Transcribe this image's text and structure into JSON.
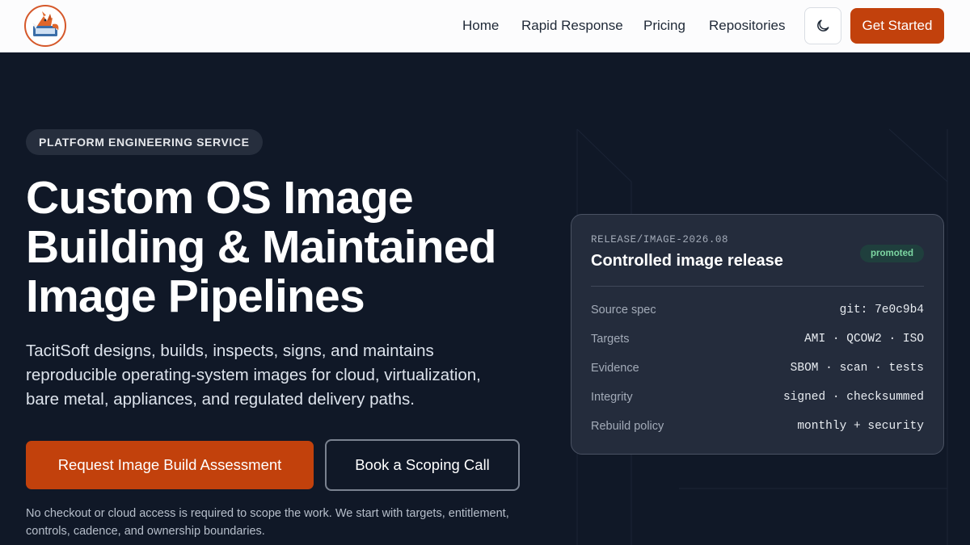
{
  "header": {
    "nav": [
      {
        "label": "Home"
      },
      {
        "label": "Rapid Response"
      },
      {
        "label": "Pricing"
      },
      {
        "label": "Repositories"
      }
    ],
    "theme_toggle_icon": "moon-icon",
    "cta_label": "Get Started"
  },
  "hero": {
    "badge": "PLATFORM ENGINEERING SERVICE",
    "title_lines": [
      "Custom OS Image",
      "Building & Maintained",
      "Image Pipelines"
    ],
    "description_lines": [
      "TacitSoft designs, builds, inspects, signs, and maintains",
      "reproducible operating-system images for cloud, virtualization,",
      "bare metal, appliances, and regulated delivery paths."
    ],
    "primary_button": "Request Image Build Assessment",
    "secondary_button": "Book a Scoping Call",
    "note_lines": [
      "No checkout or cloud access is required to scope the work. We start with targets, entitlement,",
      "controls, cadence, and ownership boundaries."
    ]
  },
  "release_card": {
    "eyebrow": "RELEASE/IMAGE-2026.08",
    "title": "Controlled image release",
    "status": "promoted",
    "rows": [
      {
        "label": "Source spec",
        "value": "git: 7e0c9b4"
      },
      {
        "label": "Targets",
        "value": "AMI · QCOW2 · ISO"
      },
      {
        "label": "Evidence",
        "value": "SBOM · scan · tests"
      },
      {
        "label": "Integrity",
        "value": "signed · checksummed"
      },
      {
        "label": "Rebuild policy",
        "value": "monthly + security"
      }
    ]
  },
  "colors": {
    "brand_orange": "#c2410c",
    "hero_bg": "#101827",
    "card_bg": "#242c3c",
    "status_green": "#7cd6a2"
  }
}
